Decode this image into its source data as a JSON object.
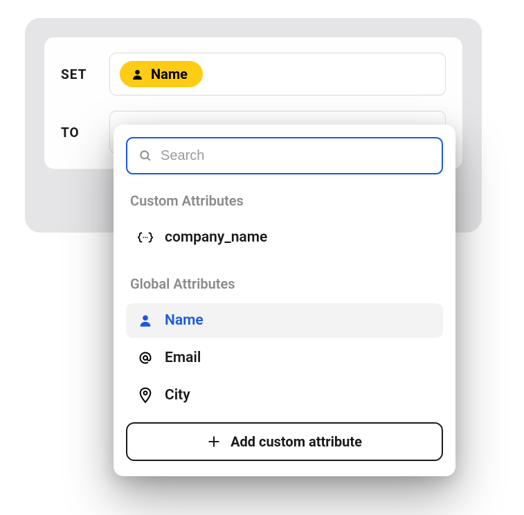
{
  "labels": {
    "set": "SET",
    "to": "TO"
  },
  "selected_chip": {
    "label": "Name",
    "icon": "person-icon"
  },
  "search": {
    "placeholder": "Search"
  },
  "sections": {
    "custom_title": "Custom Attributes",
    "global_title": "Global Attributes"
  },
  "custom_attributes": [
    {
      "label": "company_name",
      "icon": "braces-icon"
    }
  ],
  "global_attributes": [
    {
      "label": "Name",
      "icon": "person-icon",
      "selected": true
    },
    {
      "label": "Email",
      "icon": "at-icon",
      "selected": false
    },
    {
      "label": "City",
      "icon": "pin-icon",
      "selected": false
    }
  ],
  "add_button": {
    "label": "Add custom attribute"
  }
}
